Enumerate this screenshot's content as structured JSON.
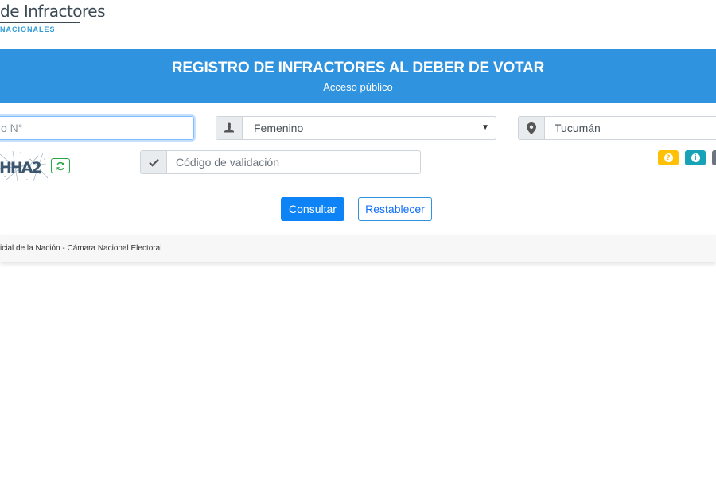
{
  "header": {
    "logo_title": "de Infractores",
    "logo_subtitle": "NACIONALES"
  },
  "banner": {
    "title": "REGISTRO DE INFRACTORES AL DEBER DE VOTAR",
    "subtitle": "Acceso público"
  },
  "form": {
    "document_placeholder": "o N°",
    "sex_value": "Femenino",
    "province_value": "Tucumán",
    "captcha_text": "HHA2",
    "validation_placeholder": "Código de validación",
    "submit_label": "Consultar",
    "reset_label": "Restablecer",
    "help_buttons": [
      {
        "icon": "question-icon",
        "color": "#ffc107"
      },
      {
        "icon": "info-icon",
        "color": "#17a2b8"
      },
      {
        "icon": "more-icon",
        "color": "#6c757d"
      }
    ]
  },
  "footer": {
    "text": "icial de la Nación - Cámara Nacional Electoral"
  },
  "colors": {
    "banner": "#2f93e0",
    "primary": "#0d83f5",
    "success": "#28a745"
  }
}
